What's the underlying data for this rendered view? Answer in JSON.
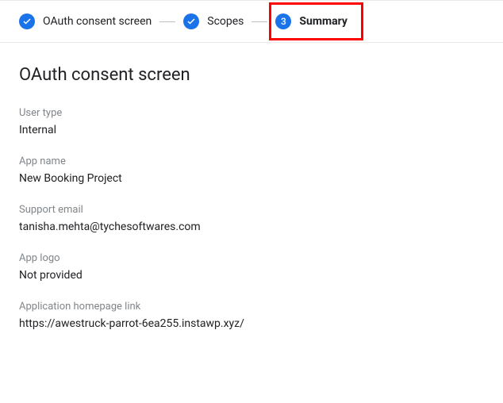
{
  "stepper": {
    "steps": [
      {
        "label": "OAuth consent screen"
      },
      {
        "label": "Scopes"
      },
      {
        "number": "3",
        "label": "Summary"
      }
    ]
  },
  "section": {
    "title": "OAuth consent screen"
  },
  "fields": {
    "user_type": {
      "label": "User type",
      "value": "Internal"
    },
    "app_name": {
      "label": "App name",
      "value": "New Booking Project"
    },
    "support_email": {
      "label": "Support email",
      "value": "tanisha.mehta@tychesoftwares.com"
    },
    "app_logo": {
      "label": "App logo",
      "value": "Not provided"
    },
    "homepage_link": {
      "label": "Application homepage link",
      "value": "https://awestruck-parrot-6ea255.instawp.xyz/"
    }
  }
}
